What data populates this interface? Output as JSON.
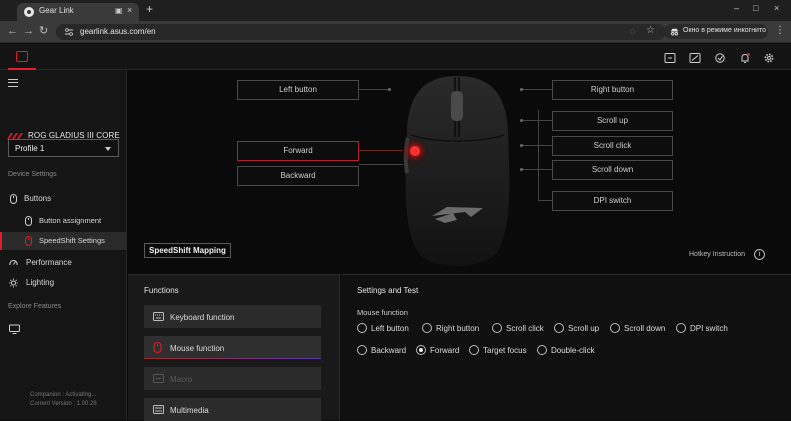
{
  "browser": {
    "tab_title": "Gear Link",
    "tab_media_icon": "▣",
    "tab_close": "×",
    "new_tab": "+",
    "url": "gearlink.asus.com/en",
    "incognito_label": "Окно в режиме инкогнито",
    "back": "←",
    "forward": "→",
    "reload": "↻",
    "minimize": "–",
    "maximize": "□",
    "close": "×",
    "menu": "⋮",
    "eye_off": "◌",
    "star": "☆"
  },
  "sidebar": {
    "device_name": "ROG GLADIUS III CORE",
    "profile": "Profile 1",
    "device_settings_header": "Device Settings",
    "items": {
      "buttons": "Buttons",
      "button_assignment": "Button assignment",
      "speedshift_settings": "SpeedShift Settings",
      "performance": "Performance",
      "lighting": "Lighting"
    },
    "explore_header": "Explore Features",
    "companion": "Companion",
    "status_companion": "Companion : Activating...",
    "status_version": "Current Version : 1.00.28"
  },
  "mouse_buttons": {
    "left_button": "Left button",
    "forward": "Forward",
    "backward": "Backward",
    "right_button": "Right button",
    "scroll_up": "Scroll up",
    "scroll_click": "Scroll click",
    "scroll_down": "Scroll down",
    "dpi_switch": "DPI switch"
  },
  "mapping_title": "SpeedShift Mapping",
  "hotkey_instruction": "Hotkey Instruction",
  "hotkey_info": "i",
  "functions": {
    "title": "Functions",
    "items": [
      "Keyboard function",
      "Mouse function",
      "Macro",
      "Multimedia"
    ]
  },
  "settings": {
    "title": "Settings and Test",
    "group_label": "Mouse function",
    "options": [
      "Left button",
      "Right button",
      "Scroll click",
      "Scroll up",
      "Scroll down",
      "DPI switch",
      "Backward",
      "Forward",
      "Target focus",
      "Double-click"
    ],
    "selected": "Forward"
  },
  "colors": {
    "accent": "#e01c2a",
    "panel": "#191919"
  }
}
